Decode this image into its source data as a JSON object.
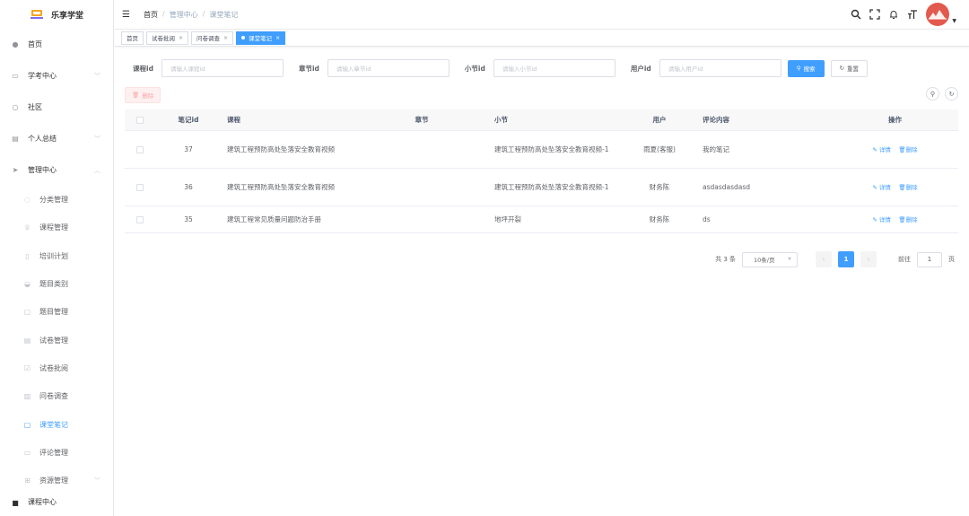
{
  "app": {
    "logo_text": "乐享学堂"
  },
  "sidebar": {
    "items": [
      {
        "label": "首页",
        "icon": "dashboard-icon"
      },
      {
        "label": "学考中心",
        "icon": "monitor-icon",
        "expandable": true
      },
      {
        "label": "社区",
        "icon": "community-icon"
      },
      {
        "label": "个人总结",
        "icon": "document-icon",
        "expandable": true
      },
      {
        "label": "管理中心",
        "icon": "send-icon",
        "expandable": true,
        "expanded": true
      }
    ],
    "sub_items": [
      {
        "label": "分类管理",
        "icon": "category-icon"
      },
      {
        "label": "课程管理",
        "icon": "trophy-icon"
      },
      {
        "label": "培训计划",
        "icon": "plan-icon"
      },
      {
        "label": "题目类别",
        "icon": "question-category-icon"
      },
      {
        "label": "题目管理",
        "icon": "question-icon"
      },
      {
        "label": "试卷管理",
        "icon": "paper-icon"
      },
      {
        "label": "试卷批阅",
        "icon": "review-icon"
      },
      {
        "label": "问卷调查",
        "icon": "survey-icon"
      },
      {
        "label": "课堂笔记",
        "icon": "note-icon",
        "active": true
      },
      {
        "label": "评论管理",
        "icon": "comment-icon"
      },
      {
        "label": "资源管理",
        "icon": "resource-icon",
        "expandable": true
      }
    ],
    "partial_item": {
      "label": "课程中心"
    }
  },
  "header": {
    "breadcrumb": [
      "首页",
      "管理中心",
      "课堂笔记"
    ],
    "separator": "/",
    "avatar_color": "#e25a4e"
  },
  "tags": [
    {
      "label": "首页",
      "closable": false
    },
    {
      "label": "试卷批阅",
      "closable": true
    },
    {
      "label": "问卷调查",
      "closable": true
    },
    {
      "label": "课堂笔记",
      "closable": true,
      "active": true
    }
  ],
  "filters": [
    {
      "label": "课程id",
      "placeholder": "请输入课程id"
    },
    {
      "label": "章节id",
      "placeholder": "请输入章节id"
    },
    {
      "label": "小节id",
      "placeholder": "请输入小节id"
    },
    {
      "label": "用户id",
      "placeholder": "请输入用户id"
    }
  ],
  "buttons": {
    "search": "搜索",
    "reset": "重置",
    "delete": "删除"
  },
  "table": {
    "headers": {
      "id": "笔记id",
      "course": "课程",
      "chapter": "章节",
      "section": "小节",
      "user": "用户",
      "comment": "评论内容",
      "ops": "操作"
    },
    "rows": [
      {
        "id": "37",
        "course": "建筑工程预防高处坠落安全教育视频",
        "chapter": "",
        "section": "建筑工程预防高处坠落安全教育视频-1",
        "user": "雨夏(客服)",
        "comment": "我的笔记"
      },
      {
        "id": "36",
        "course": "建筑工程预防高处坠落安全教育视频",
        "chapter": "",
        "section": "建筑工程预防高处坠落安全教育视频-1",
        "user": "财务陈",
        "comment": "asdasdasdasd"
      },
      {
        "id": "35",
        "course": "建筑工程常见质量问题防治手册",
        "chapter": "",
        "section": "地坪开裂",
        "user": "财务陈",
        "comment": "ds"
      }
    ],
    "op_detail": "详情",
    "op_delete": "删除"
  },
  "pagination": {
    "total_text": "共 3 条",
    "page_size": "10条/页",
    "current_page": "1",
    "goto_label": "前往",
    "goto_value": "1",
    "goto_suffix": "页"
  },
  "colors": {
    "primary": "#409eff",
    "danger_light": "#fef0f0"
  }
}
